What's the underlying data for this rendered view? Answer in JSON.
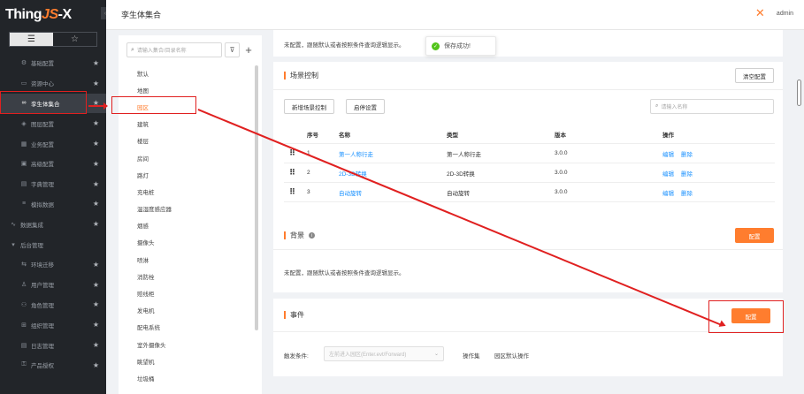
{
  "app": {
    "logo_prefix": "Thing",
    "logo_js": "JS",
    "logo_suffix": "-X",
    "collapse_glyph": "‹"
  },
  "sidebar": {
    "tabs": [
      {
        "icon": "list-icon",
        "glyph": "☰"
      },
      {
        "icon": "star-icon",
        "glyph": "☆"
      }
    ],
    "items": [
      {
        "label": "基础配置",
        "icon": "gear-icon",
        "glyph": "⚙",
        "starred": true,
        "kind": "sub"
      },
      {
        "label": "资源中心",
        "icon": "folder-icon",
        "glyph": "▭",
        "starred": true,
        "kind": "sub"
      },
      {
        "label": "孪生体集合",
        "icon": "collection-icon",
        "glyph": "∞",
        "starred": true,
        "kind": "sub",
        "active": true
      },
      {
        "label": "图层配置",
        "icon": "layers-icon",
        "glyph": "◈",
        "starred": true,
        "kind": "sub"
      },
      {
        "label": "业务配置",
        "icon": "grid-icon",
        "glyph": "▦",
        "starred": true,
        "kind": "sub"
      },
      {
        "label": "高级配置",
        "icon": "advanced-icon",
        "glyph": "▣",
        "starred": true,
        "kind": "sub"
      },
      {
        "label": "字典管理",
        "icon": "dictionary-icon",
        "glyph": "▤",
        "starred": true,
        "kind": "sub"
      },
      {
        "label": "模拟数据",
        "icon": "data-icon",
        "glyph": "≡",
        "starred": true,
        "kind": "sub"
      },
      {
        "label": "数据集成",
        "icon": "chart-icon",
        "glyph": "∿",
        "starred": true,
        "kind": "group"
      },
      {
        "label": "后台管理",
        "icon": "caret-down-icon",
        "glyph": "▾",
        "starred": false,
        "kind": "group"
      },
      {
        "label": "环境迁移",
        "icon": "migrate-icon",
        "glyph": "⇆",
        "starred": true,
        "kind": "sub"
      },
      {
        "label": "用户管理",
        "icon": "user-icon",
        "glyph": "♙",
        "starred": true,
        "kind": "sub"
      },
      {
        "label": "角色管理",
        "icon": "role-icon",
        "glyph": "⚇",
        "starred": true,
        "kind": "sub"
      },
      {
        "label": "组织管理",
        "icon": "org-icon",
        "glyph": "⊞",
        "starred": true,
        "kind": "sub"
      },
      {
        "label": "日志管理",
        "icon": "log-icon",
        "glyph": "▤",
        "starred": true,
        "kind": "sub"
      },
      {
        "label": "产品授权",
        "icon": "key-icon",
        "glyph": "⚿",
        "starred": true,
        "kind": "sub"
      }
    ],
    "star_glyph": "★"
  },
  "header": {
    "title": "孪生体集合",
    "user": "admin",
    "user_glyph": "✕"
  },
  "tree": {
    "search_placeholder": "请输入集合/目录名称",
    "search_glyph": "⌕",
    "filter_glyph": "⊽",
    "add_glyph": "+",
    "items": [
      "默认",
      "地图",
      "园区",
      "建筑",
      "楼层",
      "房间",
      "路灯",
      "充电桩",
      "温湿度感应器",
      "烟感",
      "摄像头",
      "喷淋",
      "消防栓",
      "赔线柜",
      "发电机",
      "配电系统",
      "室外摄像头",
      "眺望机",
      "垃圾桶"
    ],
    "selected_index": 2
  },
  "top_note": "未配置，跟随默认或者按照条件查询逻辑显示。",
  "toast": {
    "text": "保存成功!",
    "glyph": "✓"
  },
  "scene": {
    "title": "场景控制",
    "clear_btn": "清空配置",
    "add_btn": "新增场景控制",
    "startup_btn": "启停设置",
    "search_placeholder": "请输入名称",
    "columns": [
      "序号",
      "名称",
      "类型",
      "版本",
      "操作"
    ],
    "rows": [
      {
        "idx": "1",
        "name": "第一人称行走",
        "type": "第一人称行走",
        "version": "3.0.0"
      },
      {
        "idx": "2",
        "name": "2D-3D转换",
        "type": "2D-3D转换",
        "version": "3.0.0"
      },
      {
        "idx": "3",
        "name": "自动旋转",
        "type": "自动旋转",
        "version": "3.0.0"
      }
    ],
    "op_edit": "编辑",
    "op_delete": "删除",
    "drag_glyph": "⠿"
  },
  "background": {
    "title": "背景",
    "info_glyph": "i",
    "config_btn": "配置",
    "note": "未配置，跟随默认或者按照条件查询逻辑显示。"
  },
  "event": {
    "title": "事件",
    "config_btn": "配置",
    "trigger_label": "触发条件:",
    "trigger_placeholder": "左前进入园区(Enter.evt/Forward)",
    "chevron_glyph": "⌄",
    "op_set_label": "操作集",
    "op_set_value": "园区默认操作"
  },
  "colors": {
    "accent": "#ff7d2e",
    "link": "#1890ff",
    "sidebar_bg": "#222529",
    "annotation": "#e02020",
    "success": "#52c41a"
  }
}
